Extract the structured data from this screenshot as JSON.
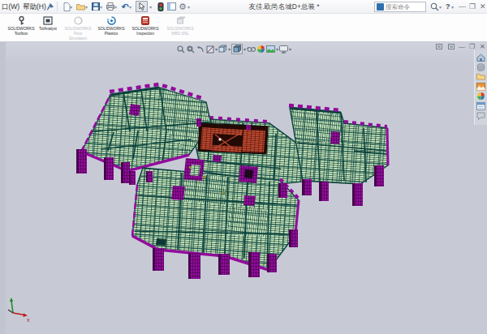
{
  "titlebar": {
    "menu_items": [
      "口(W)",
      "帮助(H)"
    ],
    "title": "友佳.欧尚名城D+总装 *",
    "search_placeholder": "搜索命令",
    "help": "?"
  },
  "commandmanager": {
    "buttons": [
      {
        "lines": [
          "SOLIDWORKS",
          "Toolbox"
        ],
        "enabled": true
      },
      {
        "lines": [
          "TolAnalyst"
        ],
        "enabled": true
      },
      {
        "lines": [
          "SOLIDWORKS",
          "Flow",
          "Simulation"
        ],
        "enabled": false
      },
      {
        "lines": [
          "SOLIDWORKS",
          "Plastics"
        ],
        "enabled": true
      },
      {
        "lines": [
          "SOLIDWORKS",
          "Inspection"
        ],
        "enabled": true
      },
      {
        "lines": [
          "SOLIDWORKS",
          "MBD SNL"
        ],
        "enabled": false
      }
    ]
  },
  "triad": {
    "x_label": "x"
  },
  "colors": {
    "bg": "#c7cad5",
    "green": "#c6e8c0",
    "greenline": "#1e4639",
    "purple": "#930c9c",
    "purpledark": "#46044c",
    "teal": "#0a423d",
    "red": "#bf4a30",
    "reddark": "#50140c",
    "accent": "#2f6fae"
  }
}
